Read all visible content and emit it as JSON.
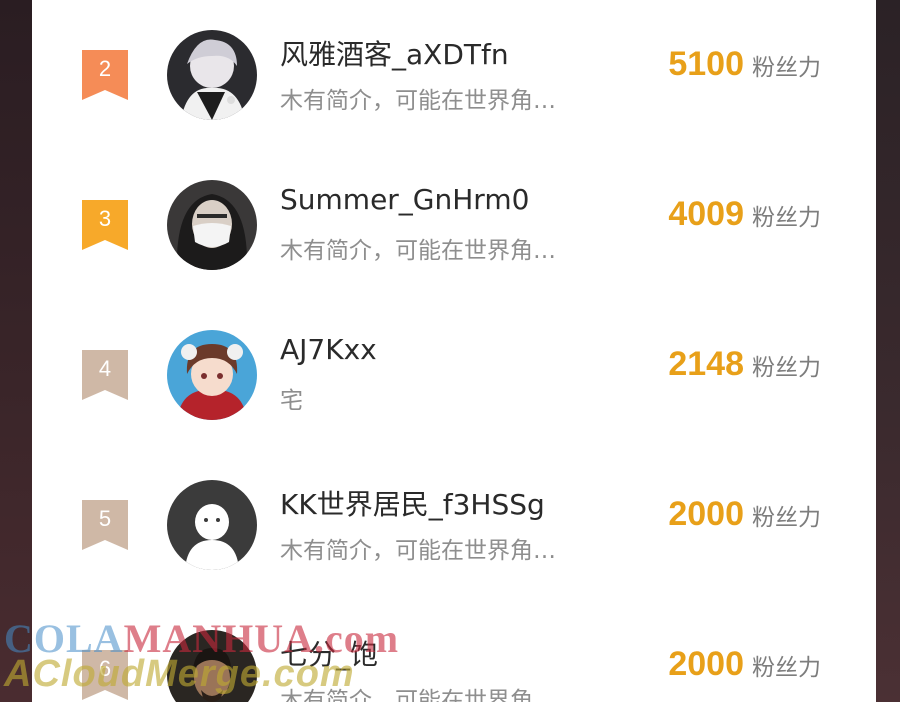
{
  "score_unit": "粉丝力",
  "colors": {
    "rank2": "#f58c57",
    "rank3": "#f7a92a",
    "rank_other": "#cfb8a6",
    "score": "#e8a019"
  },
  "users": [
    {
      "rank": "2",
      "name": "风雅酒客_aXDTfn",
      "bio": "木有简介，可能在世界角…",
      "score": "5100",
      "avatar": "anime-boy-avatar"
    },
    {
      "rank": "3",
      "name": "Summer_GnHrm0",
      "bio": "木有简介，可能在世界角…",
      "score": "4009",
      "avatar": "masked-girl-avatar"
    },
    {
      "rank": "4",
      "name": "AJ7Kxx",
      "bio": "宅",
      "score": "2148",
      "avatar": "anime-girl-avatar"
    },
    {
      "rank": "5",
      "name": "KK世界居民_f3HSSg",
      "bio": "木有简介，可能在世界角…",
      "score": "2000",
      "avatar": "default-avatar"
    },
    {
      "rank": "6",
      "name": "七分_饱",
      "bio": "木有简介，可能在世界角…",
      "score": "2000",
      "avatar": "man-avatar"
    }
  ],
  "watermark": {
    "line1_a": "COLA",
    "line1_b": "MANHUA.com",
    "line2": "ACloudMerge.com"
  }
}
